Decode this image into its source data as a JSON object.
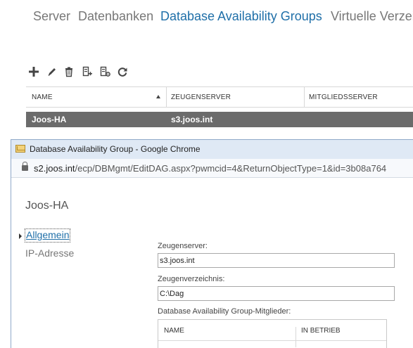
{
  "topnav": {
    "items": [
      "Server",
      "Datenbanken",
      "Database Availability Groups",
      "Virtuelle Verzeic"
    ],
    "active_index": 2
  },
  "toolbar": {
    "icons": [
      "add-icon",
      "edit-icon",
      "delete-icon",
      "manage-membership-icon",
      "configure-network-icon",
      "refresh-icon"
    ]
  },
  "grid": {
    "columns": [
      "NAME",
      "ZEUGENSERVER",
      "MITGLIEDSSERVER"
    ],
    "sort_column": "NAME",
    "rows": [
      {
        "name": "Joos-HA",
        "witness_server": "s3.joos.int",
        "member_servers": ""
      }
    ]
  },
  "popup": {
    "window_title": "Database Availability Group - Google Chrome",
    "url_host": "s2.joos.int",
    "url_rest": "/ecp/DBMgmt/EditDAG.aspx?pwmcid=4&ReturnObjectType=1&id=3b08a764",
    "page_title": "Joos-HA",
    "nav": {
      "general": "Allgemein",
      "ip": "IP-Adresse"
    },
    "form": {
      "witness_server_label": "Zeugenserver:",
      "witness_server_value": "s3.joos.int",
      "witness_dir_label": "Zeugenverzeichnis:",
      "witness_dir_value": "C:\\Dag",
      "members_label": "Database Availability Group-Mitglieder:",
      "members_columns": [
        "NAME",
        "IN BETRIEB"
      ]
    }
  },
  "colors": {
    "accent": "#1f6fa8",
    "selected_row": "#6b6b6b",
    "titlebar": "#dfe9f5"
  }
}
